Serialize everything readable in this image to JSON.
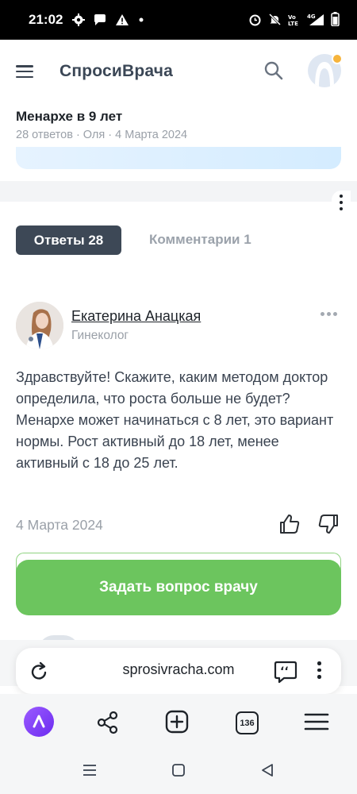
{
  "status_bar": {
    "time": "21:02",
    "left_icons": [
      "gear-icon",
      "chat-bubble-icon",
      "warning-icon",
      "dot-icon"
    ],
    "right_icons": [
      "alarm-icon",
      "mute-icon",
      "volte-icon",
      "signal-4g-icon",
      "battery-icon"
    ]
  },
  "header": {
    "brand": "СпросиВрача",
    "menu_icon": "hamburger-icon",
    "search_icon": "search-icon",
    "notification_color": "#f6b43c"
  },
  "question": {
    "title": "Менархе в 9 лет",
    "meta": "28 ответов · Оля · 4 Марта 2024"
  },
  "tabs": {
    "answers": "Ответы 28",
    "comments": "Комментарии 1"
  },
  "answer": {
    "author_name": "Екатерина Анацкая",
    "author_role": "Гинеколог",
    "paragraph_1": "Здравствуйте! Скажите, каким методом доктор определила, что роста больше не будет?",
    "paragraph_2": "Менархе может начинаться с 8 лет, это вариант нормы. Рост активный до 18 лет, менее активный с 18 до 25 лет.",
    "date": "4 Марта 2024"
  },
  "cta": {
    "label": "Задать вопрос врачу",
    "color": "#6cc55e"
  },
  "browser": {
    "url": "sprosivracha.com",
    "tabs_count": "136",
    "nav_icons": [
      "alice-icon",
      "share-icon",
      "new-tab-icon",
      "tabs-icon",
      "menu-icon"
    ]
  },
  "system_nav": {
    "icons": [
      "recent-apps-icon",
      "home-icon",
      "back-icon"
    ]
  }
}
